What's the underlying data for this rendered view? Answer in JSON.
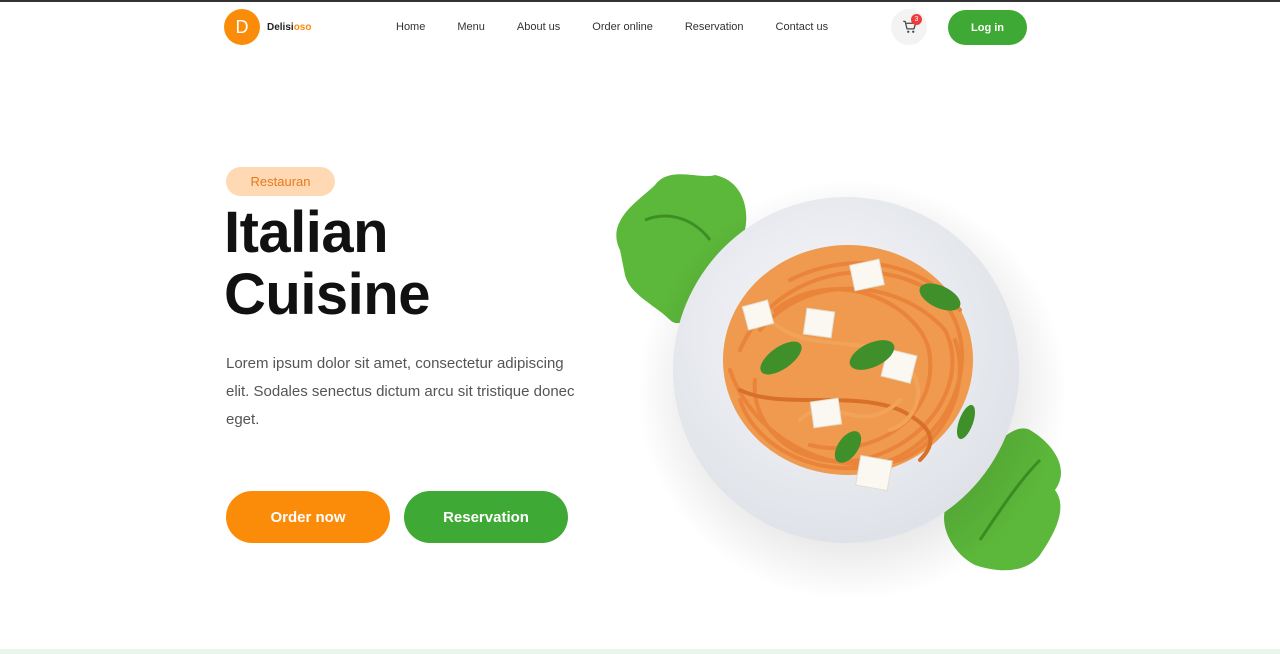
{
  "header": {
    "logo_letter": "D",
    "brand_part1": "Delisi",
    "brand_part2": "oso",
    "nav": [
      "Home",
      "Menu",
      "About us",
      "Order online",
      "Reservation",
      "Contact us"
    ],
    "cart_count": "3",
    "login_label": "Log in"
  },
  "hero": {
    "tag": "Restauran",
    "title_line1": "Italian",
    "title_line2": "Cuisine",
    "description": "Lorem ipsum dolor sit amet, consectetur adipiscing elit. Sodales senectus dictum arcu sit tristique donec eget.",
    "order_label": "Order now",
    "reservation_label": "Reservation"
  },
  "colors": {
    "accent_orange": "#fb8c0a",
    "accent_green": "#3ea934",
    "tag_bg": "#fed9b4"
  },
  "icons": [
    "cart-icon"
  ]
}
